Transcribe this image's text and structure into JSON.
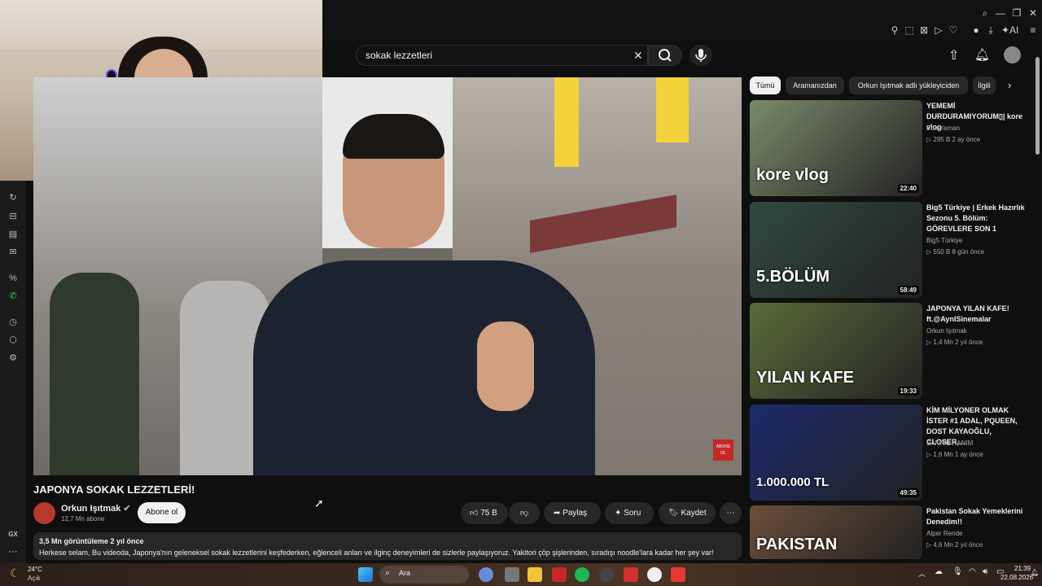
{
  "search": {
    "query": "sokak lezzetleri"
  },
  "video": {
    "title": "JAPONYA SOKAK LEZZETLERİ!",
    "overlay_badge": "ABONE OL"
  },
  "channel": {
    "name": "Orkun Işıtmak",
    "subscribers": "12,7 Mn abone",
    "subscribe_label": "Abone ol"
  },
  "actions": {
    "likes": "75 B",
    "share": "Paylaş",
    "ask": "Soru",
    "save": "Kaydet"
  },
  "description": {
    "meta": "3,5 Mn görüntüleme  2 yıl önce",
    "text": "Herkese selam, Bu videoda, Japonya'nın geleneksel sokak lezzetlerini keşfederken, eğlenceli anları ve ilginç deneyimleri de sizlerle paylaşıyoruz. Yakitori çöp şişlerinden, sıradışı noodle'lara kadar her şey var!"
  },
  "chips": [
    "Tümü",
    "Aramanızdan",
    "Orkun Işıtmak adlı yükleyiciden",
    "İlgili"
  ],
  "recommendations": [
    {
      "title": "YEMEMİ DURDURAMIYORUM▯| kore vlog",
      "channel": "Eda Yaman",
      "meta": "▷ 295 B   2 ay önce",
      "duration": "22:40",
      "thumb_text": "kore vlog",
      "thumb_color": "#7b8a6a"
    },
    {
      "title": "Big5 Türkiye | Erkek Hazırlık Sezonu 5. Bölüm: GÖREVLERE SON 1",
      "channel": "Big5 Türkiye",
      "meta": "▷ 550 B   8 gün önce",
      "duration": "58:49",
      "thumb_text": "5.BÖLÜM",
      "thumb_color": "#2f4a3f"
    },
    {
      "title": "JAPONYA YILAN KAFE! ft.@AynISinemalar",
      "channel": "Orkun Işıtmak",
      "meta": "▷ 1,4 Mn   2 yıl önce",
      "duration": "19:33",
      "thumb_text": "YILAN KAFE",
      "thumb_color": "#5a6b3a"
    },
    {
      "title": "KİM MİLYONER OLMAK İSTER #1 ADAL, PQUEEN, DOST KAYAOĞLU, CLOSER,...",
      "channel": "SANİYE HANIM",
      "meta": "▷ 1,6 Mn   1 ay önce",
      "duration": "49:35",
      "thumb_text": "1.000.000 TL",
      "thumb_color": "#1c2a6b"
    },
    {
      "title": "Pakistan Sokak Yemeklerini Denedim!!",
      "channel": "Alper Rende",
      "meta": "▷ 4,6 Mn   2 yıl önce",
      "duration": "",
      "thumb_text": "PAKISTAN",
      "thumb_color": "#6a4e3a"
    }
  ],
  "sidebar": {
    "footer_label": "GX"
  },
  "taskbar": {
    "weather_temp": "24°C",
    "weather_desc": "Açık",
    "search_label": "Ara",
    "time": "21:39",
    "date": "22.08.2026"
  },
  "colors": {
    "accent_red": "#ff0000",
    "bg": "#0f0f0f",
    "chip_bg": "#272727"
  }
}
